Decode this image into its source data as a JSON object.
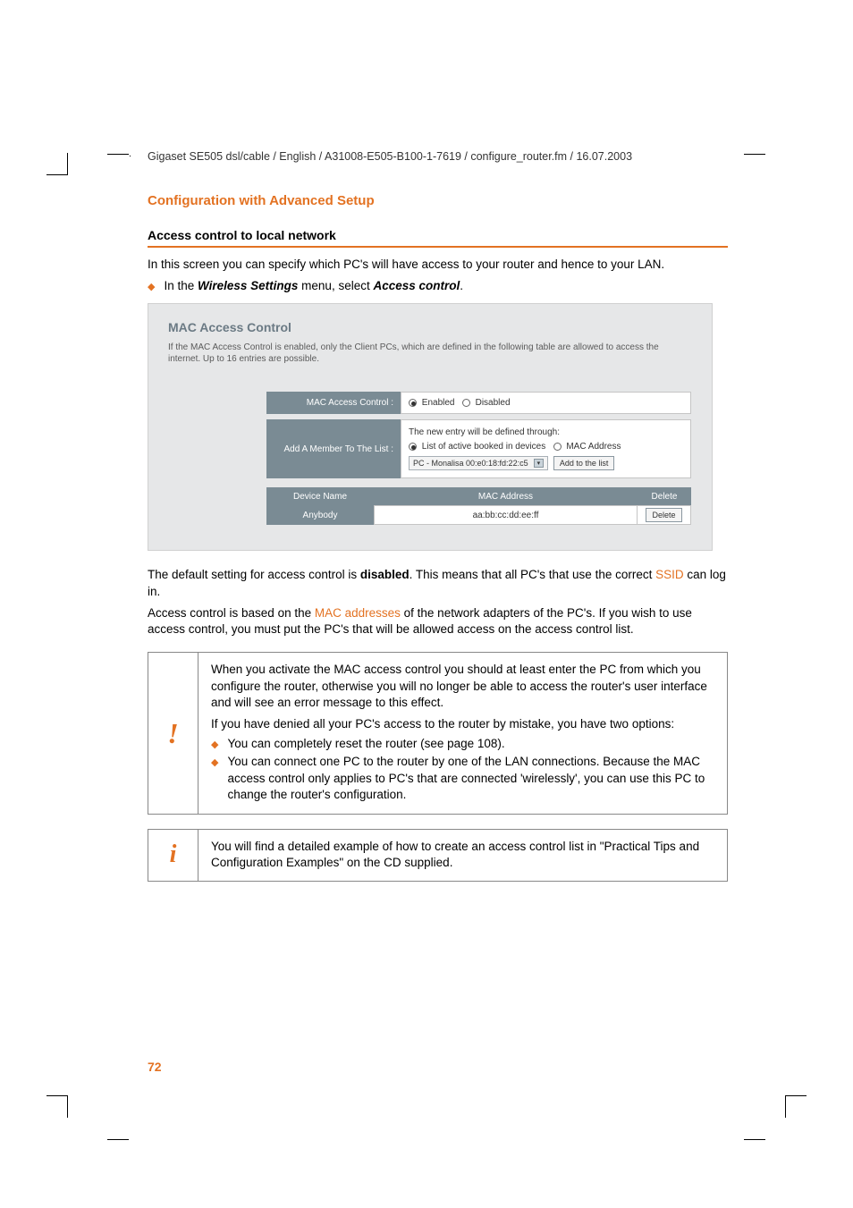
{
  "header_path": "Gigaset SE505 dsl/cable / English / A31008-E505-B100-1-7619 / configure_router.fm / 16.07.2003",
  "section_title": "Configuration with Advanced Setup",
  "sub_title": "Access control to local network",
  "intro_text": "In this screen you can specify which PC's will have access to your router and hence to your LAN.",
  "bullet_intro_pre": "In the ",
  "bullet_intro_bold1": "Wireless Settings",
  "bullet_intro_mid": " menu, select ",
  "bullet_intro_bold2": "Access control",
  "bullet_intro_post": ".",
  "panel": {
    "title": "MAC Access Control",
    "desc": "If the MAC Access Control is enabled, only the Client PCs, which are defined in the following table are allowed to access the internet. Up to 16 entries are possible.",
    "row1_label": "MAC Access Control :",
    "row1_enabled": "Enabled",
    "row1_disabled": "Disabled",
    "row2_label": "Add A Member To The List :",
    "row2_line1": "The new entry will be defined through:",
    "row2_opt1": "List of active booked in devices",
    "row2_opt2": "MAC Address",
    "row2_select": "PC - Monalisa 00:e0:18:fd:22:c5",
    "row2_btn": "Add to the list",
    "th_device": "Device Name",
    "th_mac": "MAC Address",
    "th_del": "Delete",
    "td_device": "Anybody",
    "td_mac": "aa:bb:cc:dd:ee:ff",
    "td_del": "Delete"
  },
  "para1_pre": "The default setting for access control is ",
  "para1_bold": "disabled",
  "para1_mid": ". This means that all PC's that use the correct ",
  "para1_link": "SSID",
  "para1_post": " can log in.",
  "para2_pre": "Access control is based on the ",
  "para2_link": "MAC addresses",
  "para2_post": " of the network adapters of the PC's. If you wish to use access control, you must put the PC's that will be allowed access on the access control list.",
  "warn": {
    "p1": "When you activate the MAC access control you should at least enter the PC from which you configure the router, otherwise you will no longer be able to access the router's user interface and will see an error message to this effect.",
    "p2": "If you have denied all your PC's access to the router by mistake, you have two options:",
    "b1": "You can completely reset the router (see page 108).",
    "b2": "You can connect one PC to the router by one of the LAN connections. Because the MAC access control only applies to PC's that are connected 'wirelessly', you can use this PC to change the router's configuration."
  },
  "info": "You will find a detailed example of how to create an access control list in \"Practical Tips and Configuration Examples\" on the CD supplied.",
  "page_num": "72"
}
